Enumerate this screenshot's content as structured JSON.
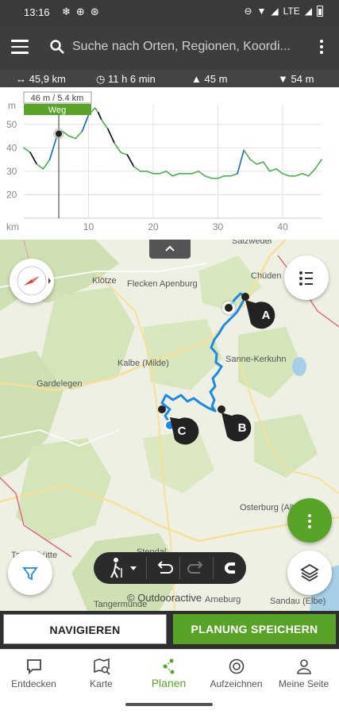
{
  "status_bar": {
    "time": "13:16",
    "carrier": "LTE"
  },
  "header": {
    "search_placeholder": "Suche nach Orten, Regionen, Koordi..."
  },
  "stats": {
    "distance": "45,9 km",
    "duration": "11 h 6 min",
    "ascent": "45 m",
    "descent": "54 m"
  },
  "chart_data": {
    "type": "line",
    "ylabel": "m",
    "xlabel": "km",
    "y_ticks": [
      "50",
      "40",
      "30",
      "20"
    ],
    "x_ticks": [
      "10",
      "20",
      "30",
      "40"
    ],
    "xlim": [
      0,
      46
    ],
    "ylim": [
      10,
      55
    ],
    "cursor": {
      "x": 5.4,
      "y": 46,
      "label": "46 m / 5.4 km",
      "tag": "Weg"
    },
    "x": [
      0,
      1,
      2,
      3,
      4,
      5,
      5.4,
      6,
      7,
      8,
      9,
      10,
      11,
      11.5,
      12,
      13,
      14,
      15,
      16,
      17,
      18,
      19,
      20,
      21,
      22,
      23,
      24,
      25,
      26,
      27,
      28,
      29,
      30,
      31,
      32,
      33,
      34,
      35,
      36,
      37,
      38,
      39,
      40,
      41,
      42,
      43,
      44,
      45,
      46
    ],
    "y": [
      40,
      38,
      33,
      31,
      35,
      44,
      46,
      47,
      45,
      44,
      47,
      54,
      57,
      55,
      52,
      48,
      42,
      38,
      37,
      32,
      30,
      30,
      29,
      29,
      30,
      28,
      29,
      29,
      29,
      30,
      28,
      27,
      27,
      28,
      28,
      29,
      39,
      35,
      33,
      34,
      30,
      31,
      29,
      28,
      28,
      29,
      28,
      31,
      35
    ],
    "colors": {
      "line": "#4caf50",
      "steep_up": "#1565c0",
      "steep_down": "#000000"
    }
  },
  "map": {
    "place_labels": [
      "Salzwedel",
      "Chüden",
      "Klötze",
      "Flecken Apenburg",
      "Sanne-Kerkuhn",
      "Kalbe (Milde)",
      "Gardelegen",
      "Osterburg (Altmark)",
      "Stendal",
      "Tangermünde",
      "Arneburg",
      "Sandau (Elbe)",
      "Tangerhütte"
    ],
    "waypoints": [
      "A",
      "B",
      "C"
    ],
    "copyright": "© Outdooractive"
  },
  "actions": {
    "navigate": "NAVIGIEREN",
    "save": "PLANUNG SPEICHERN"
  },
  "bottom_nav": [
    {
      "label": "Entdecken",
      "icon": "chat-bubble-icon"
    },
    {
      "label": "Karte",
      "icon": "map-search-icon"
    },
    {
      "label": "Planen",
      "icon": "route-plan-icon"
    },
    {
      "label": "Aufzeichnen",
      "icon": "record-icon"
    },
    {
      "label": "Meine Seite",
      "icon": "person-icon"
    }
  ],
  "colors": {
    "accent": "#5aa329",
    "route": "#1e88e5",
    "header": "#3d3d3d"
  }
}
